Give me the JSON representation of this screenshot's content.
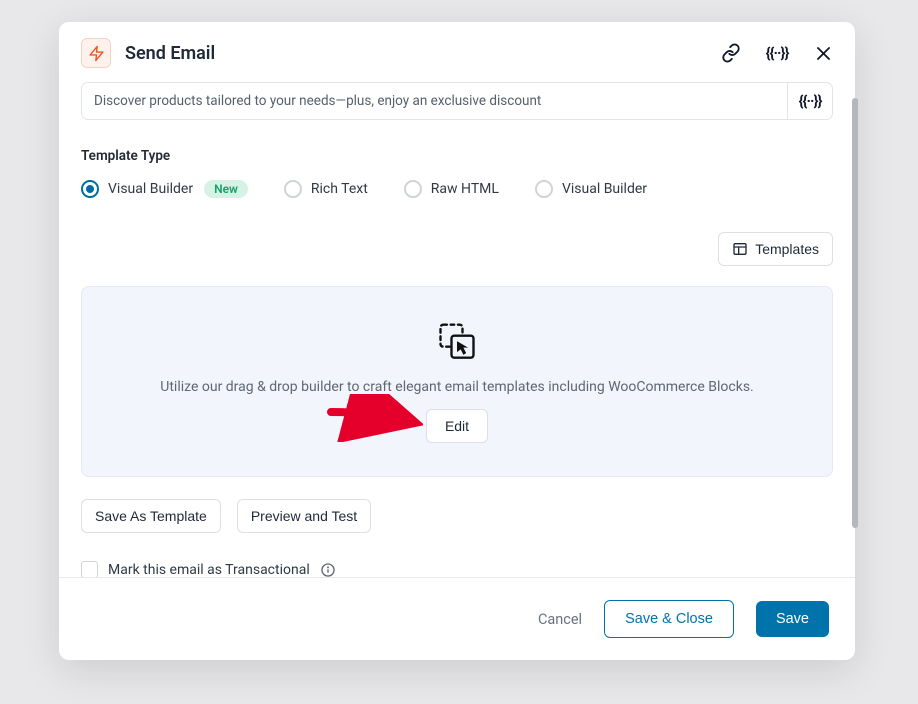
{
  "header": {
    "title": "Send Email"
  },
  "subject": {
    "value": "Discover products tailored to your needs—plus, enjoy an exclusive discount"
  },
  "template_type": {
    "label": "Template Type",
    "options": [
      {
        "label": "Visual Builder",
        "badge": "New",
        "selected": true
      },
      {
        "label": "Rich Text",
        "selected": false
      },
      {
        "label": "Raw HTML",
        "selected": false
      },
      {
        "label": "Visual Builder",
        "selected": false
      }
    ]
  },
  "templates_button": "Templates",
  "builder_box": {
    "description": "Utilize our drag & drop builder to craft elegant email templates including WooCommerce Blocks.",
    "edit": "Edit"
  },
  "actions": {
    "save_as_template": "Save As Template",
    "preview_test": "Preview and Test"
  },
  "transactional": {
    "label": "Mark this email as Transactional"
  },
  "footer": {
    "cancel": "Cancel",
    "save_close": "Save & Close",
    "save": "Save"
  }
}
